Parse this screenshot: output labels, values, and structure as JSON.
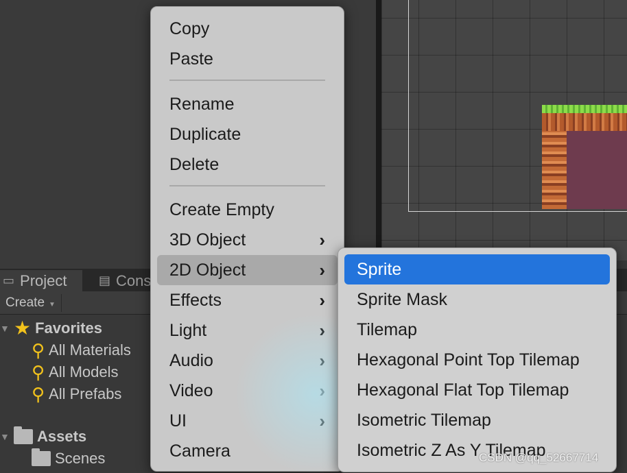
{
  "project_panel": {
    "tabs": [
      {
        "label": "Project",
        "icon": "folder-icon"
      },
      {
        "label": "Cons",
        "icon": "console-icon"
      }
    ],
    "create_label": "Create",
    "favorites_label": "Favorites",
    "favorites": [
      "All Materials",
      "All Models",
      "All Prefabs"
    ],
    "assets_label": "Assets",
    "assets_children": [
      "Scenes"
    ]
  },
  "context_menu": {
    "items": [
      {
        "label": "Copy"
      },
      {
        "label": "Paste"
      },
      {
        "label": "Rename"
      },
      {
        "label": "Duplicate"
      },
      {
        "label": "Delete"
      },
      {
        "label": "Create Empty"
      },
      {
        "label": "3D Object",
        "submenu": true
      },
      {
        "label": "2D Object",
        "submenu": true,
        "highlighted": true
      },
      {
        "label": "Effects",
        "submenu": true
      },
      {
        "label": "Light",
        "submenu": true
      },
      {
        "label": "Audio",
        "submenu": true
      },
      {
        "label": "Video",
        "submenu": true
      },
      {
        "label": "UI",
        "submenu": true
      },
      {
        "label": "Camera"
      }
    ]
  },
  "submenu_2d_object": {
    "items": [
      {
        "label": "Sprite",
        "selected": true
      },
      {
        "label": "Sprite Mask"
      },
      {
        "label": "Tilemap"
      },
      {
        "label": "Hexagonal Point Top Tilemap"
      },
      {
        "label": "Hexagonal Flat Top Tilemap"
      },
      {
        "label": "Isometric Tilemap"
      },
      {
        "label": "Isometric Z As Y Tilemap"
      }
    ]
  },
  "watermark": "CSDN @qq_52667714",
  "colors": {
    "menu_bg": "#c9c9c9",
    "selection_blue": "#2374dc",
    "highlight_gray": "#a9a9a9",
    "favorites_icon": "#f2c21c"
  }
}
